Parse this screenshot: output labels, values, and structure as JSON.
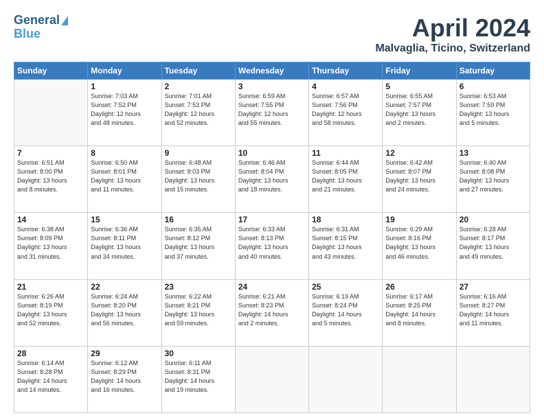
{
  "header": {
    "logo_line1": "General",
    "logo_line2": "Blue",
    "month": "April 2024",
    "location": "Malvaglia, Ticino, Switzerland"
  },
  "days_of_week": [
    "Sunday",
    "Monday",
    "Tuesday",
    "Wednesday",
    "Thursday",
    "Friday",
    "Saturday"
  ],
  "weeks": [
    [
      {
        "day": "",
        "info": ""
      },
      {
        "day": "1",
        "info": "Sunrise: 7:03 AM\nSunset: 7:52 PM\nDaylight: 12 hours\nand 48 minutes."
      },
      {
        "day": "2",
        "info": "Sunrise: 7:01 AM\nSunset: 7:53 PM\nDaylight: 12 hours\nand 52 minutes."
      },
      {
        "day": "3",
        "info": "Sunrise: 6:59 AM\nSunset: 7:55 PM\nDaylight: 12 hours\nand 55 minutes."
      },
      {
        "day": "4",
        "info": "Sunrise: 6:57 AM\nSunset: 7:56 PM\nDaylight: 12 hours\nand 58 minutes."
      },
      {
        "day": "5",
        "info": "Sunrise: 6:55 AM\nSunset: 7:57 PM\nDaylight: 13 hours\nand 2 minutes."
      },
      {
        "day": "6",
        "info": "Sunrise: 6:53 AM\nSunset: 7:59 PM\nDaylight: 13 hours\nand 5 minutes."
      }
    ],
    [
      {
        "day": "7",
        "info": "Sunrise: 6:51 AM\nSunset: 8:00 PM\nDaylight: 13 hours\nand 8 minutes."
      },
      {
        "day": "8",
        "info": "Sunrise: 6:50 AM\nSunset: 8:01 PM\nDaylight: 13 hours\nand 11 minutes."
      },
      {
        "day": "9",
        "info": "Sunrise: 6:48 AM\nSunset: 8:03 PM\nDaylight: 13 hours\nand 15 minutes."
      },
      {
        "day": "10",
        "info": "Sunrise: 6:46 AM\nSunset: 8:04 PM\nDaylight: 13 hours\nand 18 minutes."
      },
      {
        "day": "11",
        "info": "Sunrise: 6:44 AM\nSunset: 8:05 PM\nDaylight: 13 hours\nand 21 minutes."
      },
      {
        "day": "12",
        "info": "Sunrise: 6:42 AM\nSunset: 8:07 PM\nDaylight: 13 hours\nand 24 minutes."
      },
      {
        "day": "13",
        "info": "Sunrise: 6:40 AM\nSunset: 8:08 PM\nDaylight: 13 hours\nand 27 minutes."
      }
    ],
    [
      {
        "day": "14",
        "info": "Sunrise: 6:38 AM\nSunset: 8:09 PM\nDaylight: 13 hours\nand 31 minutes."
      },
      {
        "day": "15",
        "info": "Sunrise: 6:36 AM\nSunset: 8:11 PM\nDaylight: 13 hours\nand 34 minutes."
      },
      {
        "day": "16",
        "info": "Sunrise: 6:35 AM\nSunset: 8:12 PM\nDaylight: 13 hours\nand 37 minutes."
      },
      {
        "day": "17",
        "info": "Sunrise: 6:33 AM\nSunset: 8:13 PM\nDaylight: 13 hours\nand 40 minutes."
      },
      {
        "day": "18",
        "info": "Sunrise: 6:31 AM\nSunset: 8:15 PM\nDaylight: 13 hours\nand 43 minutes."
      },
      {
        "day": "19",
        "info": "Sunrise: 6:29 AM\nSunset: 8:16 PM\nDaylight: 13 hours\nand 46 minutes."
      },
      {
        "day": "20",
        "info": "Sunrise: 6:28 AM\nSunset: 8:17 PM\nDaylight: 13 hours\nand 49 minutes."
      }
    ],
    [
      {
        "day": "21",
        "info": "Sunrise: 6:26 AM\nSunset: 8:19 PM\nDaylight: 13 hours\nand 52 minutes."
      },
      {
        "day": "22",
        "info": "Sunrise: 6:24 AM\nSunset: 8:20 PM\nDaylight: 13 hours\nand 56 minutes."
      },
      {
        "day": "23",
        "info": "Sunrise: 6:22 AM\nSunset: 8:21 PM\nDaylight: 13 hours\nand 59 minutes."
      },
      {
        "day": "24",
        "info": "Sunrise: 6:21 AM\nSunset: 8:23 PM\nDaylight: 14 hours\nand 2 minutes."
      },
      {
        "day": "25",
        "info": "Sunrise: 6:19 AM\nSunset: 8:24 PM\nDaylight: 14 hours\nand 5 minutes."
      },
      {
        "day": "26",
        "info": "Sunrise: 6:17 AM\nSunset: 8:25 PM\nDaylight: 14 hours\nand 8 minutes."
      },
      {
        "day": "27",
        "info": "Sunrise: 6:16 AM\nSunset: 8:27 PM\nDaylight: 14 hours\nand 11 minutes."
      }
    ],
    [
      {
        "day": "28",
        "info": "Sunrise: 6:14 AM\nSunset: 8:28 PM\nDaylight: 14 hours\nand 14 minutes."
      },
      {
        "day": "29",
        "info": "Sunrise: 6:12 AM\nSunset: 8:29 PM\nDaylight: 14 hours\nand 16 minutes."
      },
      {
        "day": "30",
        "info": "Sunrise: 6:11 AM\nSunset: 8:31 PM\nDaylight: 14 hours\nand 19 minutes."
      },
      {
        "day": "",
        "info": ""
      },
      {
        "day": "",
        "info": ""
      },
      {
        "day": "",
        "info": ""
      },
      {
        "day": "",
        "info": ""
      }
    ]
  ]
}
